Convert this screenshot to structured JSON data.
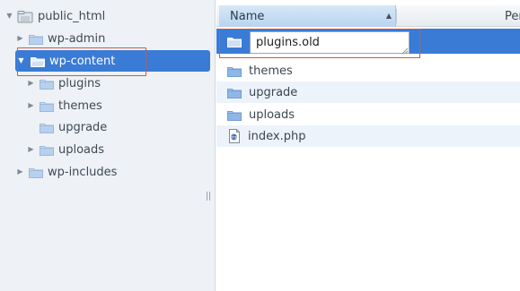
{
  "tree": {
    "root": {
      "label": "public_html",
      "icon": "home-folder-icon"
    },
    "items": [
      {
        "label": "wp-admin",
        "expandable": true,
        "selected": false
      },
      {
        "label": "wp-content",
        "expandable": true,
        "expanded": true,
        "selected": true
      },
      {
        "label": "plugins",
        "expandable": true,
        "selected": false
      },
      {
        "label": "themes",
        "expandable": true,
        "selected": false
      },
      {
        "label": "upgrade",
        "expandable": false,
        "selected": false
      },
      {
        "label": "uploads",
        "expandable": true,
        "selected": false
      },
      {
        "label": "wp-includes",
        "expandable": true,
        "selected": false
      }
    ]
  },
  "list": {
    "columns": {
      "name": "Name",
      "permissions": "Per"
    },
    "rename_value": "plugins.old",
    "rows": [
      {
        "label": "themes",
        "icon": "folder-icon"
      },
      {
        "label": "upgrade",
        "icon": "folder-icon"
      },
      {
        "label": "uploads",
        "icon": "folder-icon"
      },
      {
        "label": "index.php",
        "icon": "php-file-icon"
      }
    ]
  },
  "colors": {
    "selection": "#3a7bd5",
    "highlight_box": "#d0593d",
    "folder": "#6fa3e0",
    "tree_background": "#eef1f5"
  }
}
